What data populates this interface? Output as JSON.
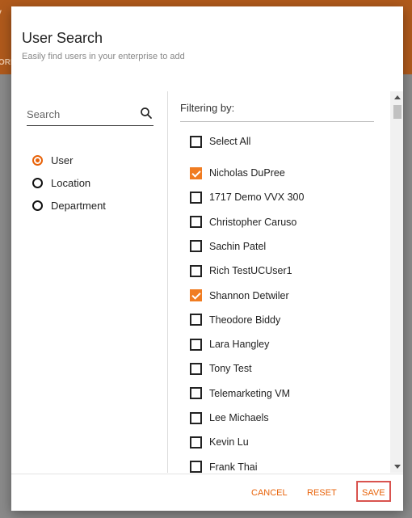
{
  "background": {
    "title_fragment": "y",
    "subtitle_fragment": "ORI"
  },
  "dialog": {
    "title": "User Search",
    "subtitle": "Easily find users in your enterprise to add"
  },
  "search": {
    "placeholder": "Search",
    "value": ""
  },
  "filter_types": [
    {
      "label": "User",
      "selected": true
    },
    {
      "label": "Location",
      "selected": false
    },
    {
      "label": "Department",
      "selected": false
    }
  ],
  "results": {
    "heading": "Filtering by:",
    "select_all_label": "Select All",
    "items": [
      {
        "label": "Nicholas DuPree",
        "checked": true
      },
      {
        "label": "1717 Demo VVX 300",
        "checked": false
      },
      {
        "label": "Christopher Caruso",
        "checked": false
      },
      {
        "label": "Sachin Patel",
        "checked": false
      },
      {
        "label": "Rich TestUCUser1",
        "checked": false
      },
      {
        "label": "Shannon Detwiler",
        "checked": true
      },
      {
        "label": "Theodore Biddy",
        "checked": false
      },
      {
        "label": "Lara Hangley",
        "checked": false
      },
      {
        "label": "Tony Test",
        "checked": false
      },
      {
        "label": "Telemarketing VM",
        "checked": false
      },
      {
        "label": "Lee Michaels",
        "checked": false
      },
      {
        "label": "Kevin Lu",
        "checked": false
      },
      {
        "label": "Frank Thai",
        "checked": false
      }
    ]
  },
  "footer": {
    "cancel_label": "CANCEL",
    "reset_label": "RESET",
    "save_label": "SAVE"
  },
  "colors": {
    "accent": "#e8630a",
    "save_highlight": "#d9534f"
  }
}
